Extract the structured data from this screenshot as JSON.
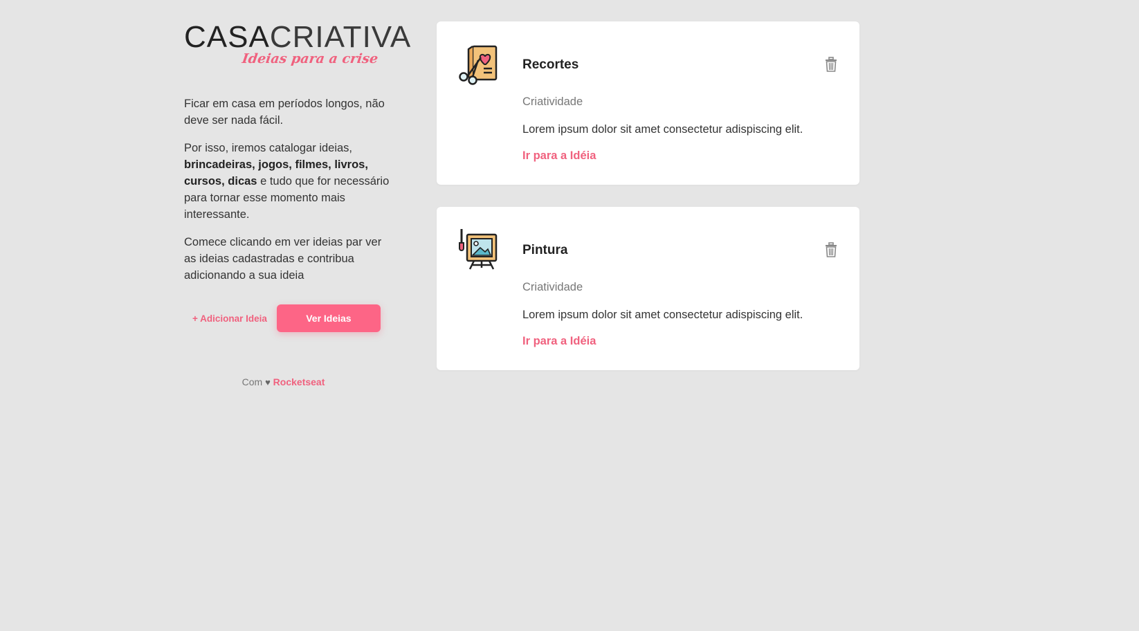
{
  "logo": {
    "main_bold": "CASA",
    "main_light": "CRIATIVA",
    "tagline": "Ideias para a crise"
  },
  "intro": {
    "p1": "Ficar em casa em períodos longos, não deve ser nada fácil.",
    "p2_start": "Por isso, iremos catalogar ideias, ",
    "p2_bold": "brincadeiras, jogos, filmes, livros, cursos, dicas",
    "p2_end": " e tudo que for necessário para tornar esse momento mais interessante.",
    "p3": "Comece clicando em ver ideias par ver as ideias cadastradas e contribua adicionando a sua ideia"
  },
  "actions": {
    "add_label": "+ Adicionar Ideia",
    "view_label": "Ver Ideias"
  },
  "footer": {
    "prefix": "Com",
    "heart": "♥",
    "brand": "Rocketseat"
  },
  "cards": [
    {
      "icon": "scissors-card-icon",
      "title": "Recortes",
      "category": "Criatividade",
      "description": "Lorem ipsum dolor sit amet consectetur adispiscing elit.",
      "link": "Ir para a Idéia"
    },
    {
      "icon": "easel-painting-icon",
      "title": "Pintura",
      "category": "Criatividade",
      "description": "Lorem ipsum dolor sit amet consectetur adispiscing elit.",
      "link": "Ir para a Idéia"
    }
  ],
  "colors": {
    "background": "#e5e5e5",
    "accent": "#f0617e",
    "button": "#fd6586",
    "card": "#ffffff"
  }
}
